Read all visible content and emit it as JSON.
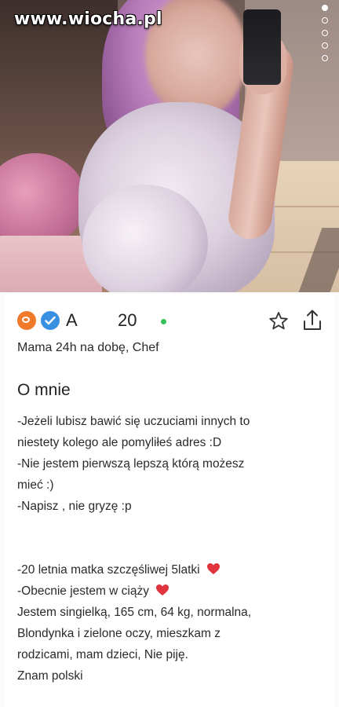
{
  "watermark": "www.wiocha.pl",
  "gallery": {
    "dot_count": 5,
    "active_index": 0
  },
  "colors": {
    "accent_orange": "#f07a2a",
    "verified_blue": "#3b8fe0",
    "online_green": "#36c25b",
    "heart_red": "#e0343f"
  },
  "profile": {
    "name": "A",
    "age": "20",
    "tagline": "Mama 24h na dobę, Chef",
    "section_title": "O mnie",
    "bio": [
      "-Jeżeli lubisz bawić się uczuciami innych to",
      "niestety kolego ale pomyliłeś adres :D",
      "-Nie jestem pierwszą lepszą którą możesz",
      "mieć :)",
      "-Napisz , nie gryzę :p",
      "-20 letnia matka szczęśliwej 5latki",
      "-Obecnie jestem w ciąży",
      "Jestem singielką, 165 cm, 64 kg, normalna,",
      "Blondynka i zielone oczy, mieszkam z",
      "rodzicami, mam dzieci, Nie piję.",
      "Znam polski"
    ]
  },
  "icons": {
    "badge_1": "orange-badge-icon",
    "badge_2": "verified-check-icon",
    "online": "online-status-dot",
    "favorite": "star-outline-icon",
    "share": "share-upload-icon",
    "heart": "red-heart-icon"
  }
}
